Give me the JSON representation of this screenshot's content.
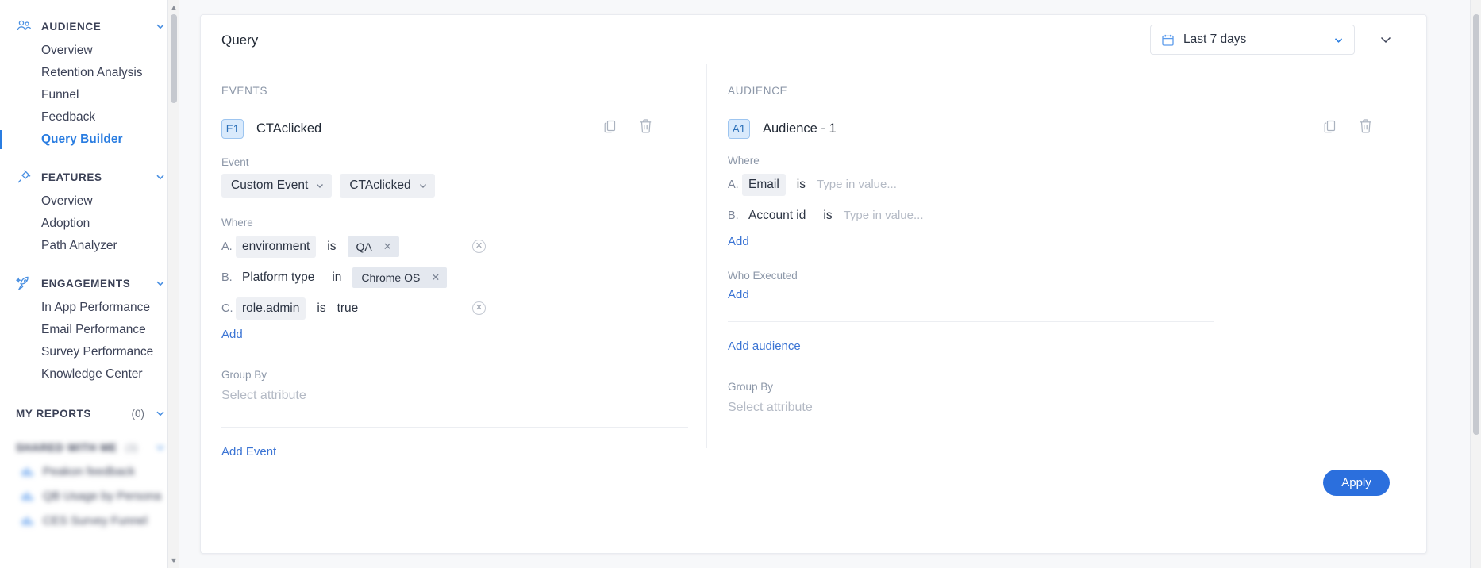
{
  "sidebar": {
    "groups": [
      {
        "title": "AUDIENCE",
        "icon": "audience-people-icon",
        "items": [
          {
            "label": "Overview",
            "active": false
          },
          {
            "label": "Retention Analysis",
            "active": false
          },
          {
            "label": "Funnel",
            "active": false
          },
          {
            "label": "Feedback",
            "active": false
          },
          {
            "label": "Query Builder",
            "active": true
          }
        ]
      },
      {
        "title": "FEATURES",
        "icon": "features-plug-icon",
        "items": [
          {
            "label": "Overview",
            "active": false
          },
          {
            "label": "Adoption",
            "active": false
          },
          {
            "label": "Path Analyzer",
            "active": false
          }
        ]
      },
      {
        "title": "ENGAGEMENTS",
        "icon": "engagements-rocket-icon",
        "items": [
          {
            "label": "In App Performance",
            "active": false
          },
          {
            "label": "Email Performance",
            "active": false
          },
          {
            "label": "Survey Performance",
            "active": false
          },
          {
            "label": "Knowledge Center",
            "active": false
          }
        ]
      }
    ],
    "my_reports": {
      "title": "MY REPORTS",
      "count": "(0)"
    },
    "shared_with_me": {
      "title": "SHARED WITH ME",
      "count": "(3)",
      "items": [
        {
          "label": "Peakon feedback"
        },
        {
          "label": "QB Usage by Persona"
        },
        {
          "label": "CES Survey Funnel"
        }
      ]
    }
  },
  "header": {
    "title": "Query",
    "date_range": "Last 7 days"
  },
  "events_panel": {
    "section_label": "EVENTS",
    "badge": "E1",
    "name": "CTAclicked",
    "event_field_label": "Event",
    "event_type_select": "Custom Event",
    "event_name_select": "CTAclicked",
    "where_label": "Where",
    "conditions": [
      {
        "letter": "A.",
        "attribute": "environment",
        "attribute_boxed": true,
        "operator": "is",
        "value_tag": "QA",
        "value_text": "",
        "removable": true
      },
      {
        "letter": "B.",
        "attribute": "Platform type",
        "attribute_boxed": false,
        "operator": "in",
        "value_tag": "Chrome OS",
        "value_text": "",
        "removable": false
      },
      {
        "letter": "C.",
        "attribute": "role.admin",
        "attribute_boxed": true,
        "operator": "is",
        "value_tag": "",
        "value_text": "true",
        "removable": true
      }
    ],
    "add_link": "Add",
    "group_by_label": "Group By",
    "group_by_placeholder": "Select attribute",
    "add_event_link": "Add Event"
  },
  "audience_panel": {
    "section_label": "AUDIENCE",
    "badge": "A1",
    "name": "Audience - 1",
    "where_label": "Where",
    "conditions": [
      {
        "letter": "A.",
        "attribute": "Email",
        "attribute_boxed": true,
        "operator": "is",
        "placeholder": "Type in value..."
      },
      {
        "letter": "B.",
        "attribute": "Account id",
        "attribute_boxed": false,
        "operator": "is",
        "placeholder": "Type in value..."
      }
    ],
    "add_link": "Add",
    "who_executed_label": "Who Executed",
    "who_executed_add": "Add",
    "add_audience_link": "Add audience",
    "group_by_label": "Group By",
    "group_by_placeholder": "Select attribute"
  },
  "footer": {
    "apply_label": "Apply"
  },
  "colors": {
    "accent_blue": "#2a7de1",
    "link_blue": "#3b74d4",
    "apply_blue": "#2b6fdd",
    "badge_bg": "#d9eafc",
    "pill_bg": "#eef0f4",
    "tag_bg": "#e4e8ef",
    "muted_text": "#8c97a8",
    "body_text": "#2c3443"
  }
}
